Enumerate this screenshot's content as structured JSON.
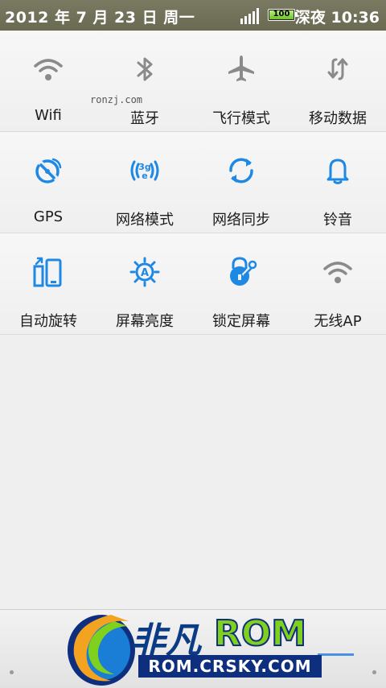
{
  "status_bar": {
    "date": "2012 年 7 月 23 日 周一",
    "battery": "100",
    "time": "深夜 10:36"
  },
  "rows": [
    [
      {
        "label": "Wifi",
        "icon": "wifi-icon",
        "active": false
      },
      {
        "label": "蓝牙",
        "icon": "bluetooth-icon",
        "active": false
      },
      {
        "label": "飞行模式",
        "icon": "airplane-icon",
        "active": false
      },
      {
        "label": "移动数据",
        "icon": "mobile-data-icon",
        "active": false
      }
    ],
    [
      {
        "label": "GPS",
        "icon": "gps-icon",
        "active": true
      },
      {
        "label": "网络模式",
        "icon": "network-mode-icon",
        "active": true
      },
      {
        "label": "网络同步",
        "icon": "sync-icon",
        "active": true
      },
      {
        "label": "铃音",
        "icon": "bell-icon",
        "active": true
      }
    ],
    [
      {
        "label": "自动旋转",
        "icon": "rotate-icon",
        "active": true
      },
      {
        "label": "屏幕亮度",
        "icon": "brightness-icon",
        "active": true
      },
      {
        "label": "锁定屏幕",
        "icon": "lock-screen-icon",
        "active": true
      },
      {
        "label": "无线AP",
        "icon": "wifi-ap-icon",
        "active": false
      }
    ]
  ],
  "watermark": "ronzj.com",
  "branding": {
    "name_cn": "非凡",
    "name_en": "ROM",
    "url": "ROM.CRSKY.COM"
  },
  "colors": {
    "active": "#1e88e5",
    "inactive": "#8a8a8a",
    "statusbar": "#72725a"
  }
}
